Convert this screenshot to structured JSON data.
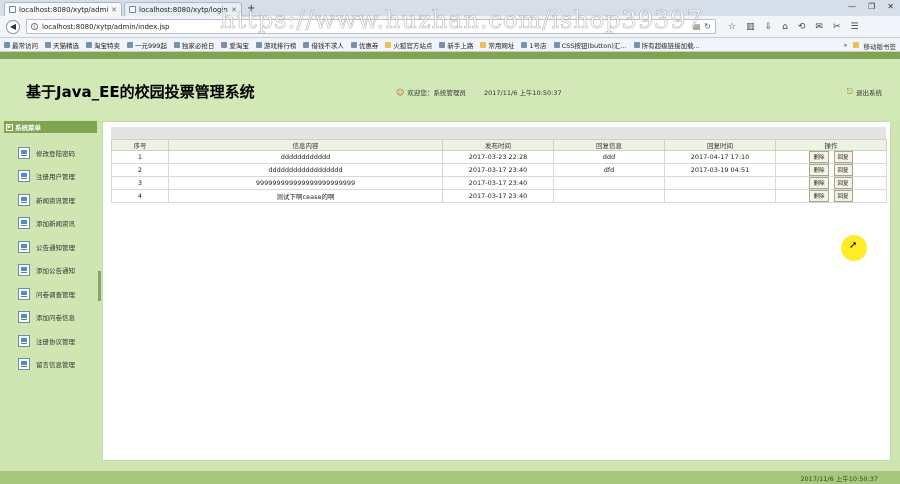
{
  "browser": {
    "tabs": [
      {
        "title": "localhost:8080/xytp/admi...",
        "active": true
      },
      {
        "title": "localhost:8080/xytp/login...",
        "active": false
      }
    ],
    "url": "localhost:8080/xytp/admin/index.jsp",
    "bookmarks": [
      {
        "label": "最常访问",
        "folder": false
      },
      {
        "label": "天猫精选",
        "folder": false
      },
      {
        "label": "淘宝特卖",
        "folder": false
      },
      {
        "label": "一元999起",
        "folder": false
      },
      {
        "label": "独家必抢日",
        "folder": false
      },
      {
        "label": "爱淘宝",
        "folder": false
      },
      {
        "label": "游戏排行榜",
        "folder": false
      },
      {
        "label": "借钱不求人",
        "folder": false
      },
      {
        "label": "优惠券",
        "folder": false
      },
      {
        "label": "火狐官方站点",
        "folder": true
      },
      {
        "label": "新手上路",
        "folder": false
      },
      {
        "label": "常用网址",
        "folder": true
      },
      {
        "label": "1号店",
        "folder": false
      },
      {
        "label": "CSS按钮(button)汇...",
        "folder": false
      },
      {
        "label": "所有超级链接加载...",
        "folder": false
      }
    ],
    "bookmarks_right": "移动版书签"
  },
  "watermark": "https://www.huzhan.com/ishop39397",
  "app": {
    "title": "基于Java_EE的校园投票管理系统",
    "welcome": "欢迎您：系统管理员",
    "datetime": "2017/11/6 上午10:50:37",
    "logout": "退出系统",
    "menu_title": "系统菜单",
    "menu": [
      "修改登陆密码",
      "注册用户管理",
      "新闻资讯管理",
      "添加新闻资讯",
      "公告通知管理",
      "添加公告通知",
      "问卷调查管理",
      "添加问卷信息",
      "注册协议管理",
      "留言信息管理"
    ],
    "table": {
      "headers": [
        "序号",
        "信息内容",
        "发布时间",
        "回复信息",
        "回复时间",
        "操作"
      ],
      "rows": [
        {
          "no": "1",
          "content": "dddddddddddd",
          "time": "2017-03-23 22:28",
          "reply": "ddd",
          "reply_time": "2017-04-17 17:10"
        },
        {
          "no": "2",
          "content": "dddddddddddddddddd",
          "time": "2017-03-17 23:40",
          "reply": "dfd",
          "reply_time": "2017-03-19 04:51"
        },
        {
          "no": "3",
          "content": "999999999999999999999999",
          "time": "2017-03-17 23:40",
          "reply": "",
          "reply_time": ""
        },
        {
          "no": "4",
          "content": "测试下啊cease的啊",
          "time": "2017-03-17 23:40",
          "reply": "",
          "reply_time": ""
        }
      ],
      "delete_label": "删除",
      "reply_label": "回复"
    },
    "footer_time": "2017/11/6 上午10:50:37"
  }
}
